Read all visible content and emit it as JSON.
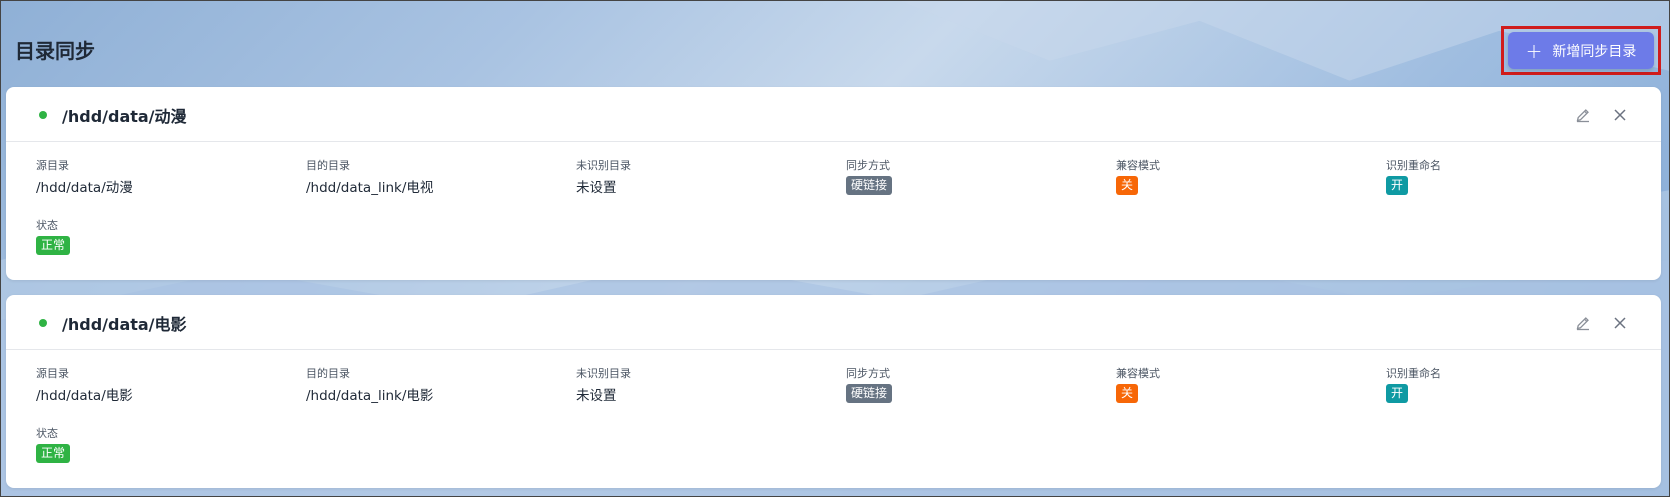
{
  "header": {
    "title": "目录同步",
    "add_button_label": "新增同步目录",
    "add_icon": "plus-icon"
  },
  "labels": {
    "source": "源目录",
    "target": "目的目录",
    "unrecognized": "未识别目录",
    "sync_mode": "同步方式",
    "compat_mode": "兼容模式",
    "rename": "识别重命名",
    "status": "状态"
  },
  "cards": [
    {
      "title": "/hdd/data/动漫",
      "source": "/hdd/data/动漫",
      "target": "/hdd/data_link/电视",
      "unrecognized": "未设置",
      "sync_mode": "硬链接",
      "compat_mode": "关",
      "rename": "开",
      "status": "正常"
    },
    {
      "title": "/hdd/data/电影",
      "source": "/hdd/data/电影",
      "target": "/hdd/data_link/电影",
      "unrecognized": "未设置",
      "sync_mode": "硬链接",
      "compat_mode": "关",
      "rename": "开",
      "status": "正常"
    }
  ],
  "colors": {
    "accent": "#6d7be8",
    "status_ok": "#2fb344",
    "badge_gray": "#667382",
    "badge_orange": "#f76707",
    "badge_teal": "#0f9aa3"
  }
}
